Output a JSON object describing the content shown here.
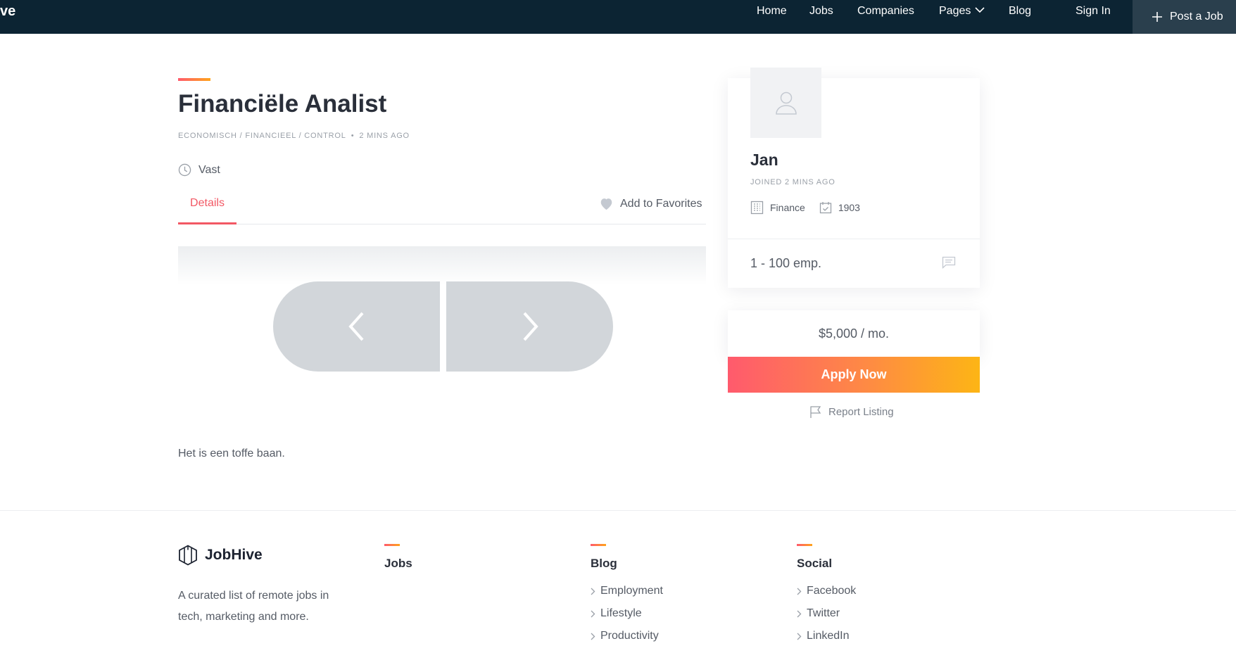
{
  "nav": {
    "brand_clip": "ve",
    "items": [
      "Home",
      "Jobs",
      "Companies",
      "Pages",
      "Blog"
    ],
    "sign_in": "Sign In",
    "post_job": "Post a Job"
  },
  "job": {
    "title": "Financiële Analist",
    "category": "ECONOMISCH / FINANCIEEL / CONTROL",
    "posted": "2 MINS AGO",
    "type": "Vast",
    "tab_details": "Details",
    "add_favorites": "Add to Favorites",
    "description": "Het is een toffe baan."
  },
  "company": {
    "name": "Jan",
    "joined": "JOINED 2 MINS AGO",
    "industry": "Finance",
    "founded": "1903",
    "employees": "1 - 100 emp."
  },
  "apply": {
    "salary": "$5,000 / mo.",
    "button": "Apply Now",
    "report": "Report Listing"
  },
  "footer": {
    "logo": "JobHive",
    "description": "A curated list of remote jobs in tech, marketing and more.",
    "jobs_heading": "Jobs",
    "blog_heading": "Blog",
    "blog_links": [
      "Employment",
      "Lifestyle",
      "Productivity"
    ],
    "social_heading": "Social",
    "social_links": [
      "Facebook",
      "Twitter",
      "LinkedIn"
    ]
  },
  "colors": {
    "nav_bg": "#0c2433",
    "accent": "#f25864",
    "gradient_start": "#ff5a6d",
    "gradient_end": "#fdb515"
  }
}
